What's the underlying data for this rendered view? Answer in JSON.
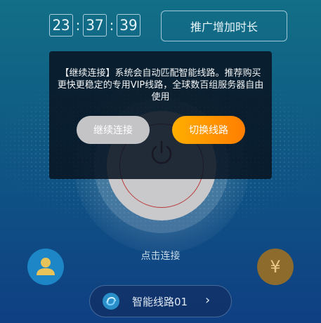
{
  "timer": {
    "hours": "23",
    "minutes": "37",
    "seconds": "39",
    "separator": ":"
  },
  "header": {
    "promo_button": "推广增加时长"
  },
  "main": {
    "connect_label": "点击连接"
  },
  "route": {
    "label": "智能线路01",
    "chevron": "›"
  },
  "coin": {
    "symbol": "¥"
  },
  "dialog": {
    "message": "【继续连接】系统会自动匹配智能线路。推荐购买更快更稳定的专用VIP线路，全球数百组服务器自由使用",
    "continue_button": "继续连接",
    "switch_button": "切换线路"
  },
  "colors": {
    "accent": "#ff9500",
    "power_ring": "#b83a3a",
    "avatar": "#1d86c6",
    "coin": "#8c6b2c"
  },
  "icons": [
    "power-icon",
    "user-icon",
    "yen-icon",
    "route-icon",
    "chevron-right-icon"
  ]
}
